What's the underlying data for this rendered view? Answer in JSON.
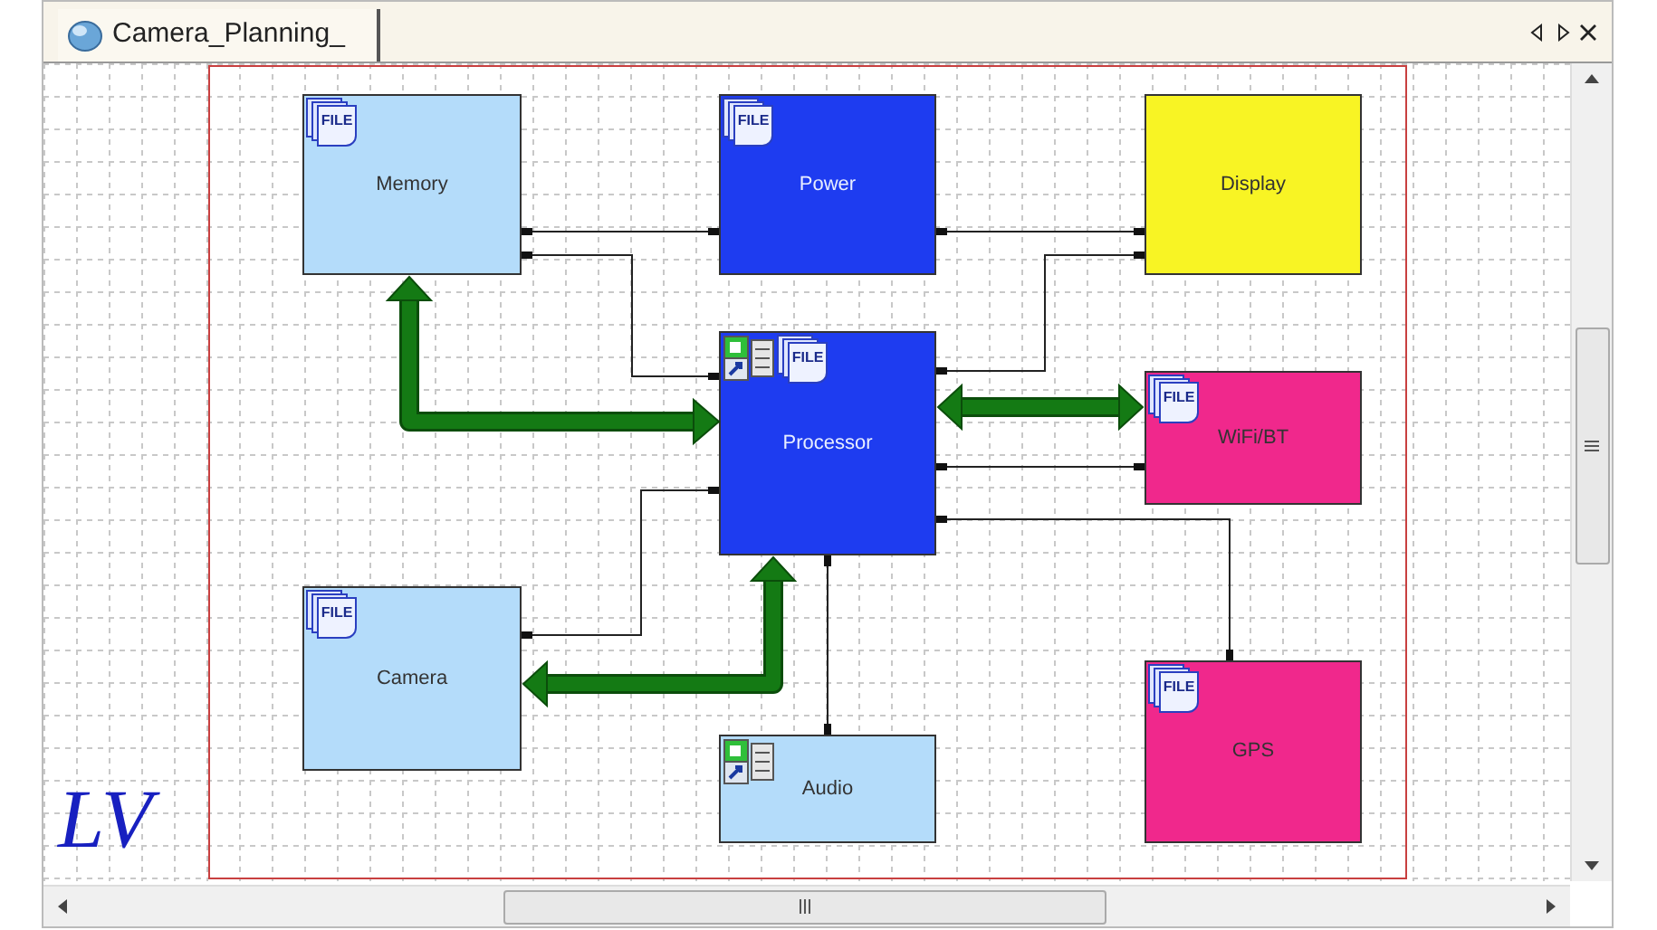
{
  "tabs": [
    {
      "title": "Camera_Planning_",
      "selected": true
    }
  ],
  "logo": "LV",
  "blocks": [
    {
      "label": "Memory",
      "color": "#b4dcfa",
      "badges": [
        {
          "kind": "file",
          "label": "FILE"
        }
      ]
    },
    {
      "label": "Power",
      "color": "#1e3cf0",
      "badges": [
        {
          "kind": "file",
          "label": "FILE"
        }
      ]
    },
    {
      "label": "Display",
      "color": "#f8f424"
    },
    {
      "label": "Processor",
      "color": "#1e3cf0",
      "badges": [
        {
          "kind": "shortcut"
        },
        {
          "kind": "file",
          "label": "FILE"
        }
      ]
    },
    {
      "label": "WiFi/BT",
      "color": "#f0288c",
      "badges": [
        {
          "kind": "file",
          "label": "FILE"
        }
      ]
    },
    {
      "label": "Camera",
      "color": "#b4dcfa",
      "badges": [
        {
          "kind": "file",
          "label": "FILE"
        }
      ]
    },
    {
      "label": "Audio",
      "color": "#b4dcfa",
      "badges": [
        {
          "kind": "shortcut"
        }
      ]
    },
    {
      "label": "GPS",
      "color": "#f0288c",
      "badges": [
        {
          "kind": "file",
          "label": "FILE"
        }
      ]
    }
  ]
}
